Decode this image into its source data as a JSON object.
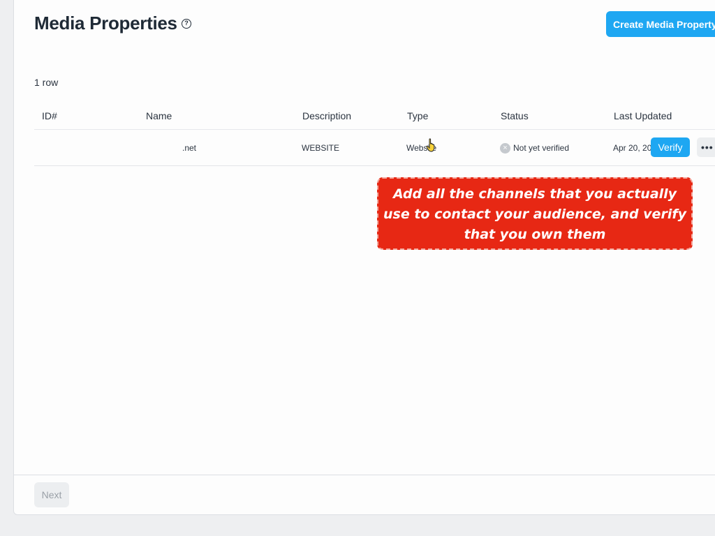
{
  "header": {
    "title": "Media Properties",
    "help_icon": "?",
    "create_button": "Create Media Property"
  },
  "table": {
    "row_count": "1 row",
    "columns": [
      "ID#",
      "Name",
      "Description",
      "Type",
      "Status",
      "Last Updated"
    ],
    "rows": [
      {
        "id": "",
        "name": ".net",
        "description": "WEBSITE",
        "type": "Website",
        "status": "Not yet verified",
        "last_updated": "Apr 20, 20",
        "verify_label": "Verify",
        "more_label": "•••"
      }
    ]
  },
  "callout": {
    "text": "Add all the channels that you actually use to contact your audience, and verify that you own them"
  },
  "footer": {
    "next_label": "Next"
  },
  "colors": {
    "accent": "#1ea7f2",
    "callout_bg": "#e72814"
  },
  "icons": {
    "help": "question-circle-icon",
    "status": "x-circle-icon",
    "cursor": "hand-pointer-icon"
  }
}
